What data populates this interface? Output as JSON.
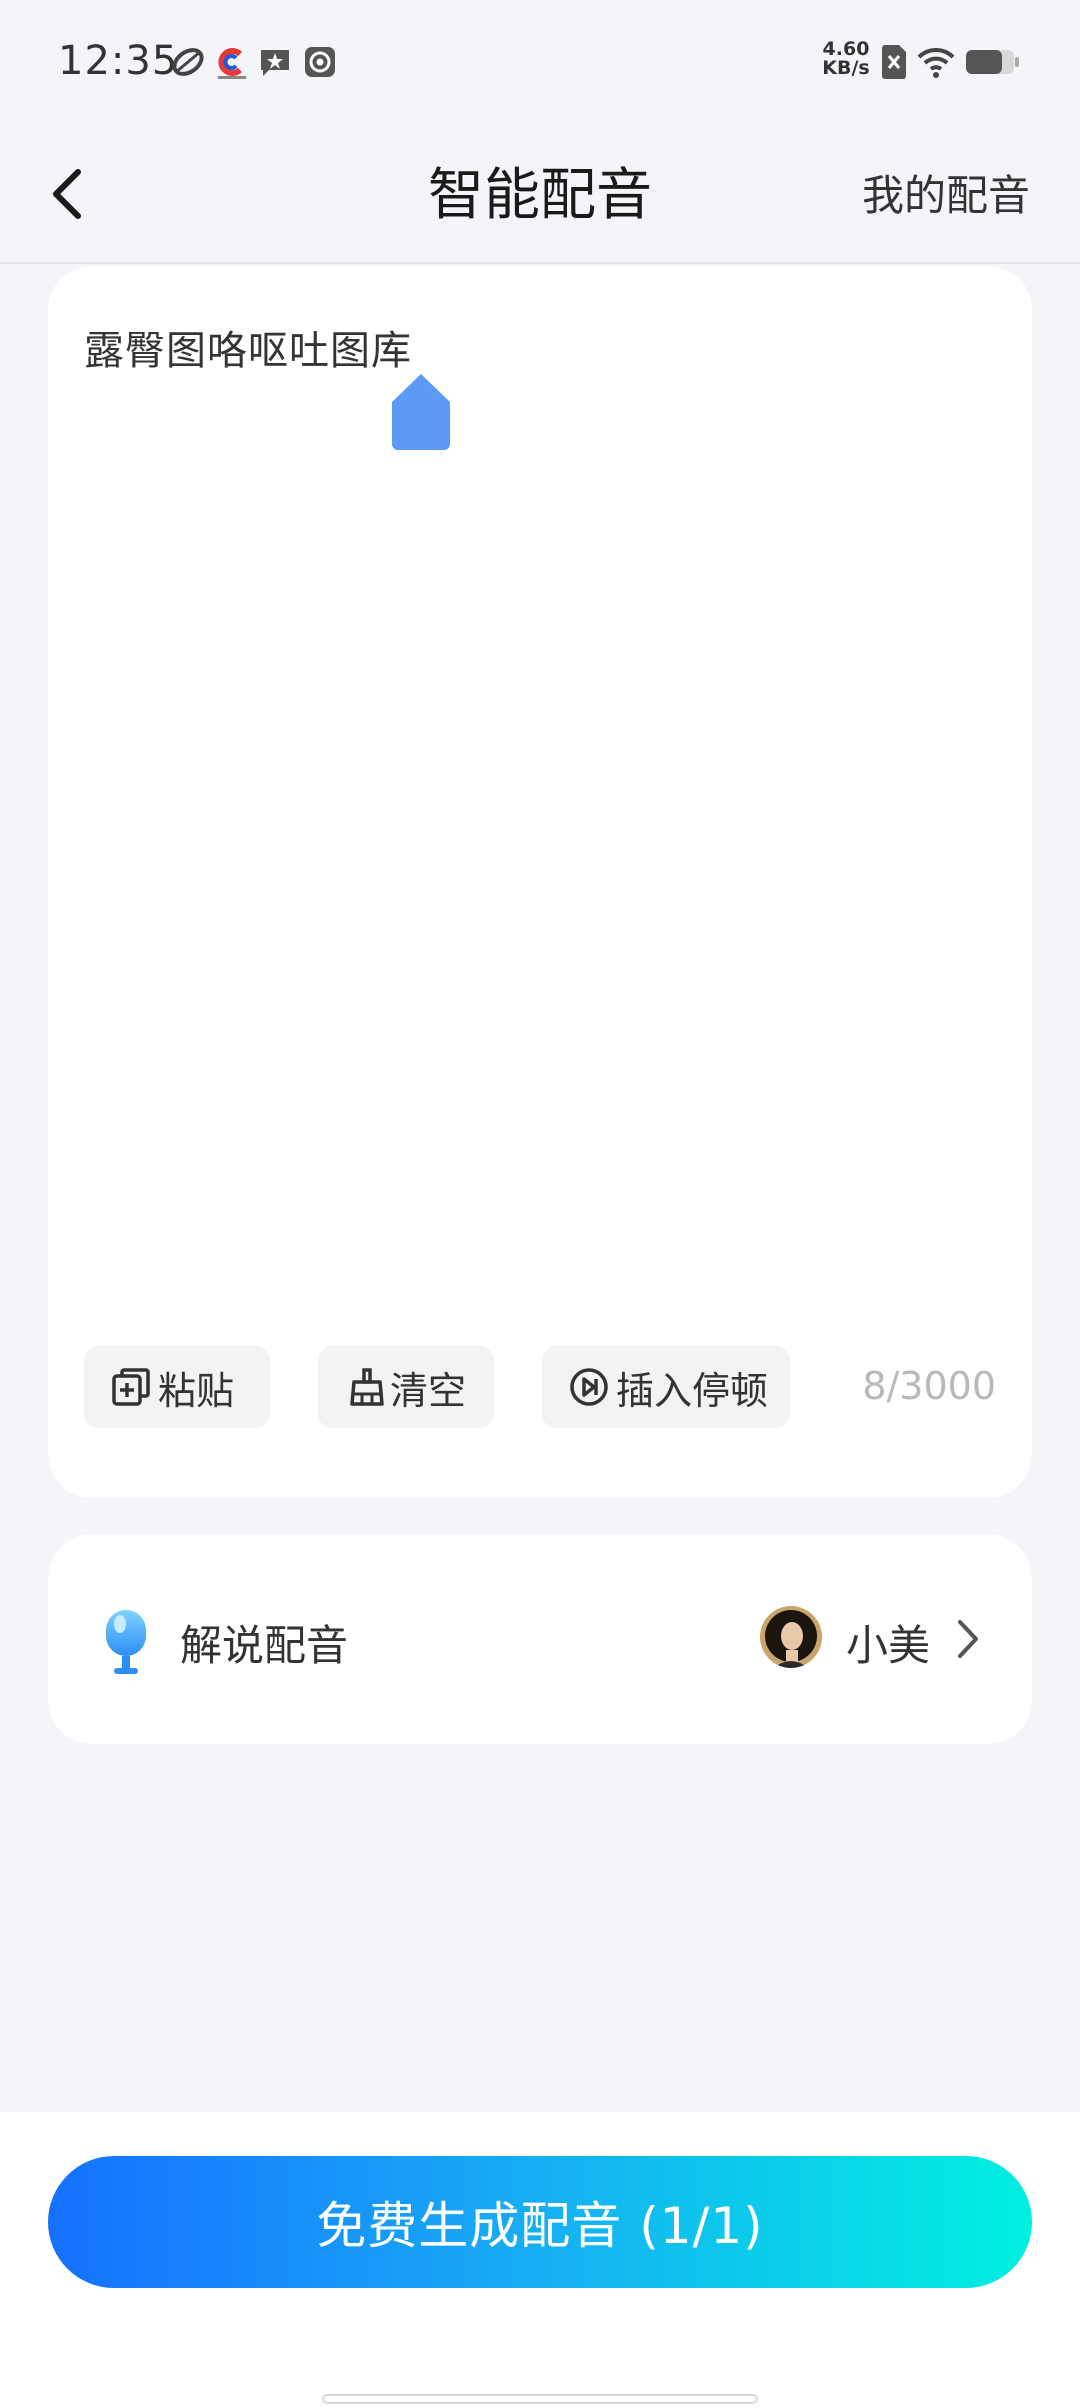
{
  "status_bar": {
    "time": "12:35",
    "net_speed_value": "4.60",
    "net_speed_unit": "KB/s",
    "icons": [
      "leaf-icon",
      "app-c-icon",
      "star-message-icon",
      "camera-icon",
      "sim-x-icon",
      "wifi-icon",
      "battery-icon"
    ]
  },
  "header": {
    "title": "智能配音",
    "right_link": "我的配音",
    "back_icon": "chevron-left-icon"
  },
  "editor": {
    "text": "露臀图咯呕吐图库",
    "paste_label": "粘贴",
    "clear_label": "清空",
    "insert_pause_label": "插入停顿",
    "char_count": "8/3000",
    "accent_color": "#5b9af5"
  },
  "voice": {
    "label": "解说配音",
    "voice_name": "小美"
  },
  "generate_button": {
    "label": "免费生成配音 (1/1)",
    "gradient_start": "#1570ff",
    "gradient_end": "#00f0e0"
  }
}
